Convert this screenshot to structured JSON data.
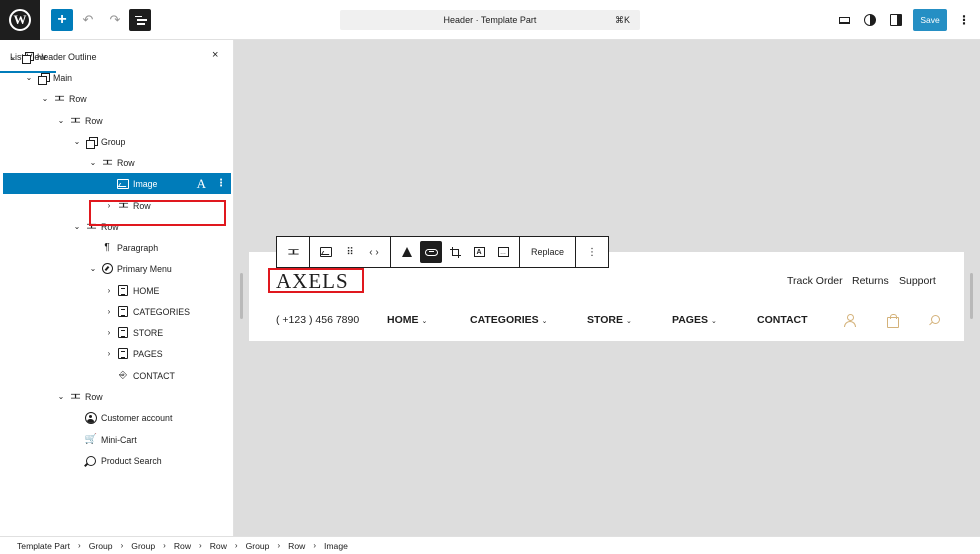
{
  "topbar": {
    "add_label": "+",
    "undo_glyph": "↶",
    "redo_glyph": "↷",
    "command_title": "Header · Template Part",
    "command_shortcut": "⌘K",
    "save_label": "Save",
    "more_glyph": "⋮",
    "icons": [
      "wordpress-logo",
      "plus",
      "undo",
      "redo",
      "document-overview",
      "laptop-preview",
      "styles-half-circle",
      "settings-sidebar",
      "more-vertical"
    ]
  },
  "panel": {
    "tabs": [
      "List View",
      "Outline"
    ],
    "close": "×"
  },
  "tree": [
    {
      "label": "Header",
      "icon": "group",
      "chev": "⌄"
    },
    {
      "label": "Main",
      "icon": "group",
      "chev": "⌄"
    },
    {
      "label": "Row",
      "icon": "row",
      "chev": "⌄"
    },
    {
      "label": "Row",
      "icon": "row",
      "chev": "⌄"
    },
    {
      "label": "Group",
      "icon": "group",
      "chev": "⌄"
    },
    {
      "label": "Row",
      "icon": "row",
      "chev": "⌄"
    },
    {
      "label": "Image",
      "icon": "image",
      "chev": "",
      "selected": true
    },
    {
      "label": "Row",
      "icon": "row",
      "chev": "›"
    },
    {
      "label": "Row",
      "icon": "row",
      "chev": "⌄"
    },
    {
      "label": "Paragraph",
      "icon": "paragraph",
      "chev": ""
    },
    {
      "label": "Primary Menu",
      "icon": "navigation",
      "chev": "⌄"
    },
    {
      "label": "HOME",
      "icon": "list",
      "chev": "›"
    },
    {
      "label": "CATEGORIES",
      "icon": "list",
      "chev": "›"
    },
    {
      "label": "STORE",
      "icon": "list",
      "chev": "›"
    },
    {
      "label": "PAGES",
      "icon": "list",
      "chev": "›"
    },
    {
      "label": "CONTACT",
      "icon": "link",
      "chev": ""
    },
    {
      "label": "Row",
      "icon": "row",
      "chev": "⌄"
    },
    {
      "label": "Customer account",
      "icon": "user",
      "chev": ""
    },
    {
      "label": "Mini-Cart",
      "icon": "cart",
      "chev": ""
    },
    {
      "label": "Product Search",
      "icon": "search",
      "chev": ""
    }
  ],
  "selected_extra": {
    "glyph": "A",
    "more": "⋮"
  },
  "canvas": {
    "logo_text": "AXELS",
    "top_links": [
      "Track Order",
      "Returns",
      "Support"
    ],
    "phone": "( +123 ) 456 7890",
    "nav": [
      {
        "label": "HOME",
        "caret": "⌄"
      },
      {
        "label": "CATEGORIES",
        "caret": "⌄"
      },
      {
        "label": "STORE",
        "caret": "⌄"
      },
      {
        "label": "PAGES",
        "caret": "⌄"
      },
      {
        "label": "CONTACT",
        "caret": ""
      }
    ],
    "accent_color": "#d4b27a"
  },
  "block_toolbar": {
    "parent_icon": "row",
    "replace_label": "Replace",
    "move_glyph": "⠿",
    "nav_glyph": "‹ ›",
    "more_glyph": "⋮"
  },
  "breadcrumb": [
    "Template Part",
    "Group",
    "Group",
    "Row",
    "Row",
    "Group",
    "Row",
    "Image"
  ],
  "breadcrumb_sep": "›",
  "colors": {
    "brand": "#007cba",
    "highlight": "#e0181e",
    "dark": "#1e1e1e"
  }
}
